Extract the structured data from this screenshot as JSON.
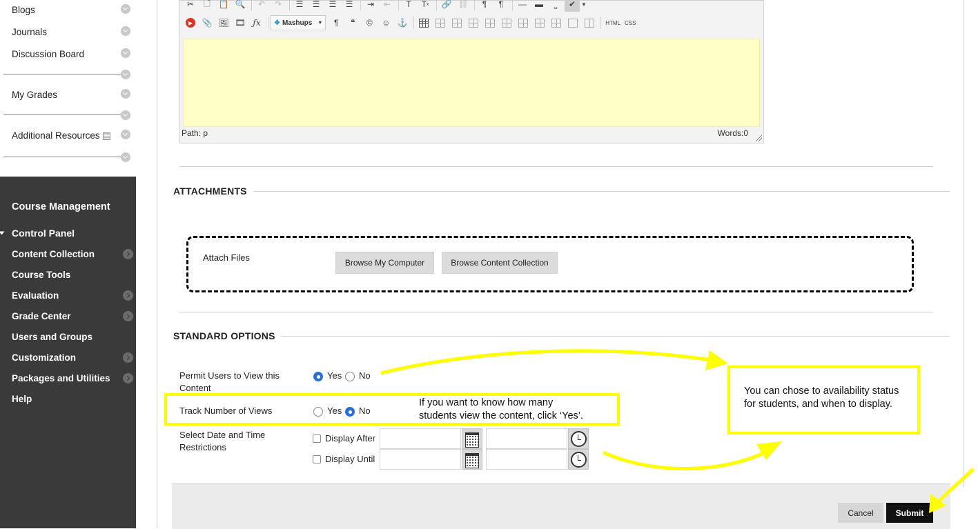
{
  "sidebar": {
    "course_items": [
      {
        "label": "Blogs"
      },
      {
        "label": "Journals"
      },
      {
        "label": "Discussion Board"
      },
      {
        "label": "My Grades"
      },
      {
        "label": "Additional Resources"
      }
    ],
    "management_title": "Course Management",
    "control_panel": "Control Panel",
    "control_items": [
      {
        "label": "Content Collection",
        "has_arrow": true
      },
      {
        "label": "Course Tools",
        "has_arrow": false
      },
      {
        "label": "Evaluation",
        "has_arrow": true
      },
      {
        "label": "Grade Center",
        "has_arrow": true
      },
      {
        "label": "Users and Groups",
        "has_arrow": false
      },
      {
        "label": "Customization",
        "has_arrow": true
      },
      {
        "label": "Packages and Utilities",
        "has_arrow": true
      },
      {
        "label": "Help",
        "has_arrow": false
      }
    ]
  },
  "editor": {
    "toolbar": {
      "mashups_label": "Mashups",
      "html_label": "HTML",
      "css_label": "CSS",
      "icons": [
        "cut-icon",
        "copy-icon",
        "paste-icon",
        "find-icon",
        "undo-icon",
        "redo-icon",
        "align-left-icon",
        "align-center-icon",
        "align-right-icon",
        "justify-icon",
        "indent-icon",
        "outdent-icon",
        "superscript-icon",
        "clear-format-icon",
        "link-icon",
        "unlink-icon",
        "ltr-icon",
        "rtl-icon",
        "hr-icon",
        "thick-hr-icon",
        "border-icon",
        "spellcheck-icon",
        "youtube-icon",
        "attach-icon",
        "image-icon",
        "media-icon",
        "math-icon",
        "paragraph-icon",
        "quote-icon",
        "copyright-icon",
        "emoji-icon",
        "anchor-icon",
        "table-icon"
      ]
    },
    "path_label": "Path: p",
    "words_label": "Words:0"
  },
  "attachments": {
    "title": "ATTACHMENTS",
    "attach_label": "Attach Files",
    "browse_computer": "Browse My Computer",
    "browse_collection": "Browse Content Collection"
  },
  "standard_options": {
    "title": "STANDARD OPTIONS",
    "permit_label": "Permit Users to View this Content",
    "permit_value": "Yes",
    "track_label": "Track Number of Views",
    "track_value": "No",
    "yes": "Yes",
    "no": "No",
    "date_label": "Select Date and Time Restrictions",
    "display_after": "Display After",
    "display_until": "Display Until"
  },
  "annotations": {
    "track_note_line1": "If you want to know how many",
    "track_note_line2": "students view the content, click ‘Yes’.",
    "avail_note_line1": "You can chose to availability status",
    "avail_note_line2": "for students, and when to display.",
    "highlight_color": "#ffff00"
  },
  "actions": {
    "cancel": "Cancel",
    "submit": "Submit"
  }
}
